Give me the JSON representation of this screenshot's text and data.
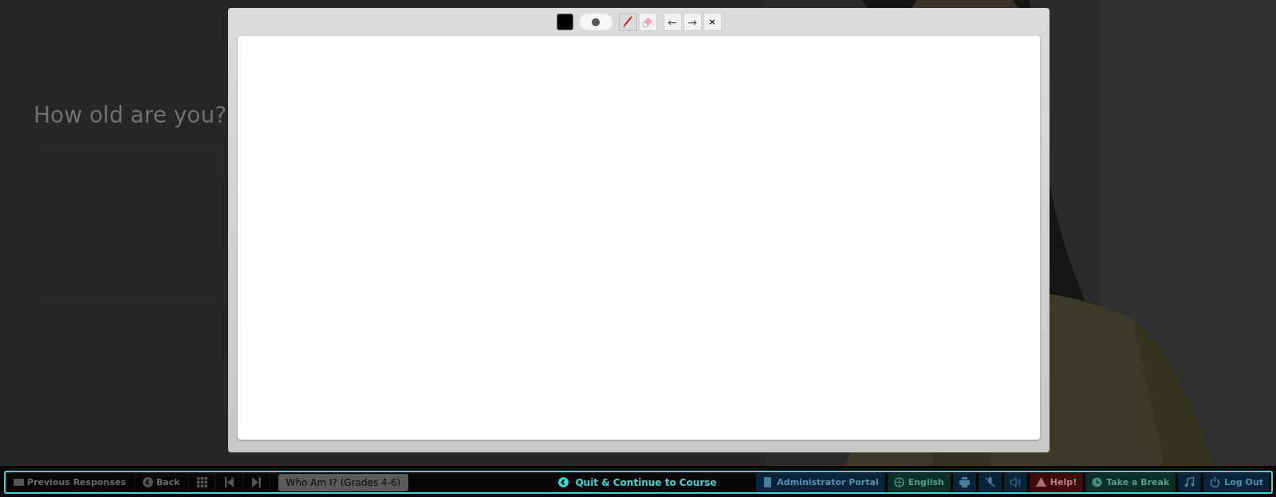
{
  "question": {
    "title": "How old are you?"
  },
  "drawing_modal": {
    "color_swatch": {
      "color": "#000000"
    },
    "brush_size": {
      "kind": "medium"
    },
    "tools": [
      {
        "kind": "pen",
        "selected": true
      },
      {
        "kind": "eraser",
        "selected": false
      }
    ],
    "history": [
      {
        "label": "←"
      },
      {
        "label": "→"
      }
    ],
    "close": {
      "label": "×"
    }
  },
  "bottom_bar": {
    "left": [
      {
        "kind": "keyboard",
        "label": "Previous Responses"
      },
      {
        "kind": "back",
        "label": "Back"
      },
      {
        "kind": "grid"
      },
      {
        "kind": "first"
      },
      {
        "kind": "last"
      }
    ],
    "course_tab": {
      "label": "Who Am I? (Grades 4-6)"
    },
    "quit_button": {
      "label": "Quit & Continue to Course"
    },
    "right": [
      {
        "kind": "admin",
        "label": "Administrator Portal",
        "color": "#04243a"
      },
      {
        "kind": "language",
        "label": "English",
        "color": "#062f28"
      },
      {
        "kind": "print",
        "color": "#04243a"
      },
      {
        "kind": "mute",
        "color": "#04243a"
      },
      {
        "kind": "audio",
        "color": "#04243a"
      },
      {
        "kind": "help",
        "label": "Help!",
        "color": "#3f0a0a"
      },
      {
        "kind": "break",
        "label": "Take a Break",
        "color": "#062f28"
      },
      {
        "kind": "music",
        "color": "#04243a"
      },
      {
        "kind": "logout",
        "label": "Log Out",
        "color": "#04243a"
      }
    ]
  }
}
